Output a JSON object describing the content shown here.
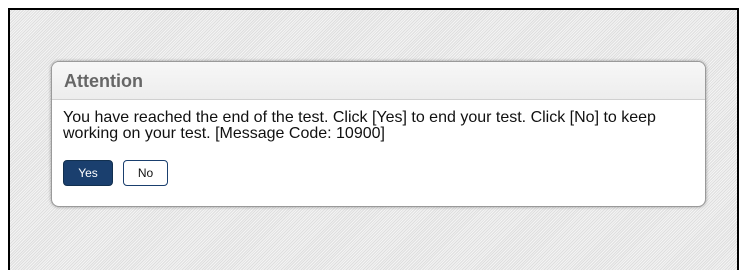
{
  "dialog": {
    "title": "Attention",
    "message": "You have reached the end of the test. Click [Yes] to end your test. Click [No] to keep working on your test. [Message Code: 10900]",
    "yes_label": "Yes",
    "no_label": "No"
  },
  "colors": {
    "primary_button": "#1a3f6e",
    "title_text": "#666666"
  }
}
